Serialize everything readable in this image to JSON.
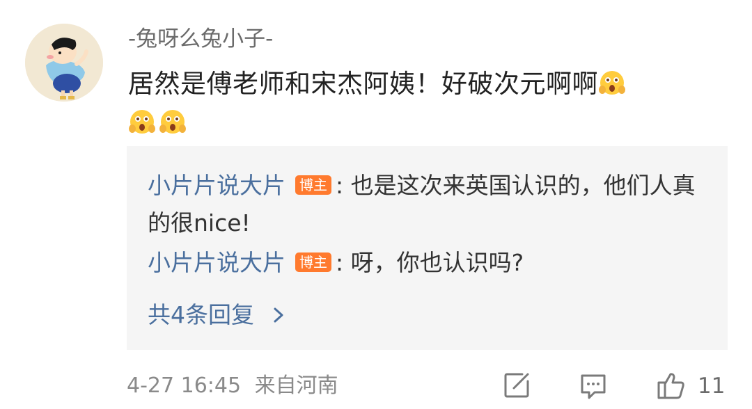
{
  "comment": {
    "username": "-兔呀么兔小子-",
    "text": "居然是傅老师和宋杰阿姨！好破次元啊啊",
    "emoji_icon": "shocked-face-icon",
    "emoji_count": 3
  },
  "replies": [
    {
      "name": "小片片说大片",
      "badge": "博主",
      "text": ": 也是这次来英国认识的，他们人真的很nice!"
    },
    {
      "name": "小片片说大片",
      "badge": "博主",
      "text": ": 呀，你也认识吗?"
    }
  ],
  "more_replies_label": "共4条回复",
  "footer": {
    "date": "4-27 16:45",
    "location": "来自河南",
    "like_count": "11",
    "icons": [
      "edit-icon",
      "comment-icon",
      "thumbs-up-icon"
    ]
  },
  "colors": {
    "reply_name": "#4a6f9e",
    "badge_bg": "#ff7a2e",
    "reply_bg": "#f5f5f5",
    "meta": "#8a8a8a"
  }
}
